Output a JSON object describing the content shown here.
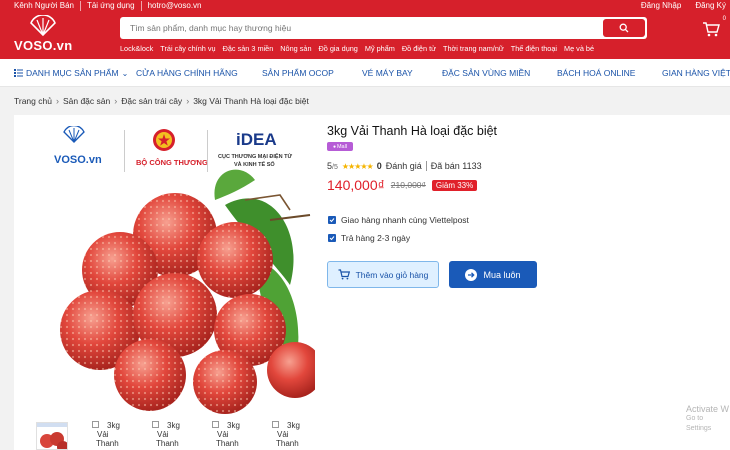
{
  "topbar": {
    "links": [
      "Kênh Người Bán",
      "Tải ứng dụng",
      "hotro@voso.vn"
    ],
    "login": "Đăng Nhập",
    "register": "Đăng Ký"
  },
  "logo": {
    "text": "VOSO.vn"
  },
  "search": {
    "placeholder": "Tìm sản phẩm, danh mục hay thương hiệu"
  },
  "quick_links": [
    "Lock&lock",
    "Trái cây chính vụ",
    "Đặc sản 3 miền",
    "Nông sản",
    "Đồ gia dụng",
    "Mỹ phẩm",
    "Đồ điện tử",
    "Thời trang nam/nữ",
    "Thế điện thoại",
    "Mẹ và bé"
  ],
  "cart": {
    "count": "0"
  },
  "nav": {
    "menu_label": "DANH MỤC SẢN PHẨM",
    "items": [
      "CỬA HÀNG CHÍNH HÃNG",
      "SẢN PHẨM OCOP",
      "VÉ MÁY BAY",
      "ĐẶC SẢN VÙNG MIỀN",
      "BÁCH HOÁ ONLINE",
      "GIAN HÀNG VIỆT"
    ]
  },
  "breadcrumb": [
    "Trang chủ",
    "Sản đặc sản",
    "Đặc sản trái cây",
    "3kg Vải Thanh Hà loại đặc biệt"
  ],
  "product_image": {
    "brand_voso": "VOSO.vn",
    "brand_ministry": "BỘ CÔNG THƯƠNG",
    "brand_idea": "iDEA",
    "brand_idea_sub1": "CỤC THƯƠNG MẠI ĐIỆN TỬ",
    "brand_idea_sub2": "VÀ KINH TẾ SỐ"
  },
  "thumbnails": {
    "alt_lines": [
      "3kg",
      "Vải",
      "Thanh"
    ]
  },
  "product": {
    "title": "3kg Vải Thanh Hà loại đặc biệt",
    "mall_badge": "Mall",
    "rating_value": "5",
    "rating_suffix": "/5",
    "review_count": "0",
    "review_label": "Đánh giá",
    "sold_label": "Đã bán 1133",
    "price": "140,000₫",
    "old_price": "210,000₫",
    "discount": "Giảm 33%",
    "features": [
      "Giao hàng nhanh cùng Viettelpost",
      "Trả hàng 2-3 ngày"
    ],
    "add_to_cart": "Thêm vào giỏ hàng",
    "buy_now": "Mua luôn"
  },
  "watermark": {
    "line1": "Activate W",
    "line2": "Go to Settings"
  },
  "colors": {
    "brand_red": "#d6202b",
    "accent_blue": "#1a5ab8",
    "price_red": "#e0202a"
  }
}
